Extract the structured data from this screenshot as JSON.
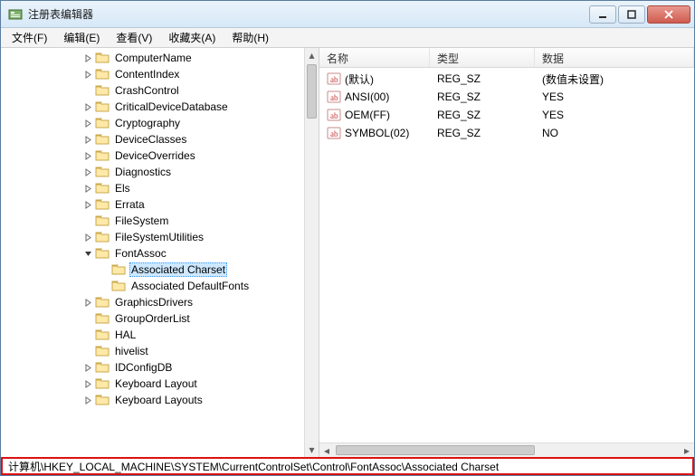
{
  "window": {
    "title": "注册表编辑器"
  },
  "menu": {
    "file": "文件(F)",
    "edit": "编辑(E)",
    "view": "查看(V)",
    "favorites": "收藏夹(A)",
    "help": "帮助(H)"
  },
  "tree": {
    "items": [
      {
        "label": "ComputerName",
        "depth": 5,
        "expander": "closed"
      },
      {
        "label": "ContentIndex",
        "depth": 5,
        "expander": "closed"
      },
      {
        "label": "CrashControl",
        "depth": 5,
        "expander": "none"
      },
      {
        "label": "CriticalDeviceDatabase",
        "depth": 5,
        "expander": "closed"
      },
      {
        "label": "Cryptography",
        "depth": 5,
        "expander": "closed"
      },
      {
        "label": "DeviceClasses",
        "depth": 5,
        "expander": "closed"
      },
      {
        "label": "DeviceOverrides",
        "depth": 5,
        "expander": "closed"
      },
      {
        "label": "Diagnostics",
        "depth": 5,
        "expander": "closed"
      },
      {
        "label": "Els",
        "depth": 5,
        "expander": "closed"
      },
      {
        "label": "Errata",
        "depth": 5,
        "expander": "closed"
      },
      {
        "label": "FileSystem",
        "depth": 5,
        "expander": "none"
      },
      {
        "label": "FileSystemUtilities",
        "depth": 5,
        "expander": "closed"
      },
      {
        "label": "FontAssoc",
        "depth": 5,
        "expander": "open"
      },
      {
        "label": "Associated Charset",
        "depth": 6,
        "expander": "none",
        "selected": true
      },
      {
        "label": "Associated DefaultFonts",
        "depth": 6,
        "expander": "none"
      },
      {
        "label": "GraphicsDrivers",
        "depth": 5,
        "expander": "closed"
      },
      {
        "label": "GroupOrderList",
        "depth": 5,
        "expander": "none"
      },
      {
        "label": "HAL",
        "depth": 5,
        "expander": "none"
      },
      {
        "label": "hivelist",
        "depth": 5,
        "expander": "none"
      },
      {
        "label": "IDConfigDB",
        "depth": 5,
        "expander": "closed"
      },
      {
        "label": "Keyboard Layout",
        "depth": 5,
        "expander": "closed"
      },
      {
        "label": "Keyboard Layouts",
        "depth": 5,
        "expander": "closed"
      }
    ]
  },
  "list": {
    "columns": {
      "name": "名称",
      "type": "类型",
      "data": "数据"
    },
    "rows": [
      {
        "name": "(默认)",
        "type": "REG_SZ",
        "data": "(数值未设置)"
      },
      {
        "name": "ANSI(00)",
        "type": "REG_SZ",
        "data": "YES"
      },
      {
        "name": "OEM(FF)",
        "type": "REG_SZ",
        "data": "YES"
      },
      {
        "name": "SYMBOL(02)",
        "type": "REG_SZ",
        "data": "NO"
      }
    ]
  },
  "status": {
    "path": "计算机\\HKEY_LOCAL_MACHINE\\SYSTEM\\CurrentControlSet\\Control\\FontAssoc\\Associated Charset"
  }
}
